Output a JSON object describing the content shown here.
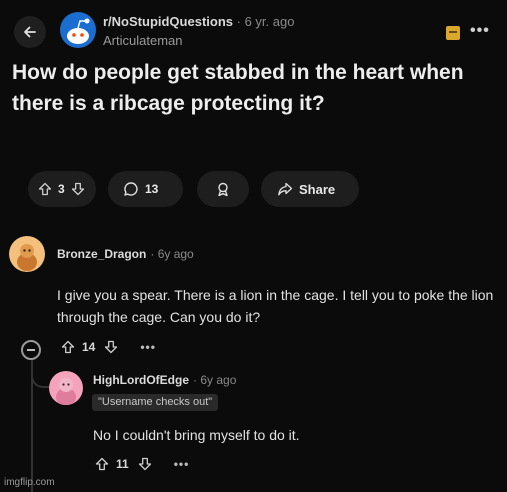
{
  "header": {
    "subreddit": "r/NoStupidQuestions",
    "post_age": "6 yr. ago",
    "author": "Articulateman",
    "more": "•••",
    "separator": "·"
  },
  "post": {
    "title": "How do people get stabbed in the heart when there is a ribcage protecting it?",
    "votes": "3",
    "comments": "13",
    "share_label": "Share"
  },
  "comments": [
    {
      "username": "Bronze_Dragon",
      "age": "6y ago",
      "body": "I give you a spear. There is a lion in the cage. I tell you to poke the lion through the cage. Can you do it?",
      "votes": "14",
      "more": "•••"
    },
    {
      "username": "HighLordOfEdge",
      "age": "6y ago",
      "flair": "\"Username checks out\"",
      "body": "No I couldn't bring myself to do it.",
      "votes": "11",
      "more": "•••"
    }
  ],
  "watermark": "imgflip.com",
  "colors": {
    "background": "#0b0b0b",
    "pill": "#1e1e1e",
    "subreddit_avatar": "#1c6dd0",
    "avatar_orange": "#f3c07e",
    "avatar_pink": "#f5a3bd"
  }
}
